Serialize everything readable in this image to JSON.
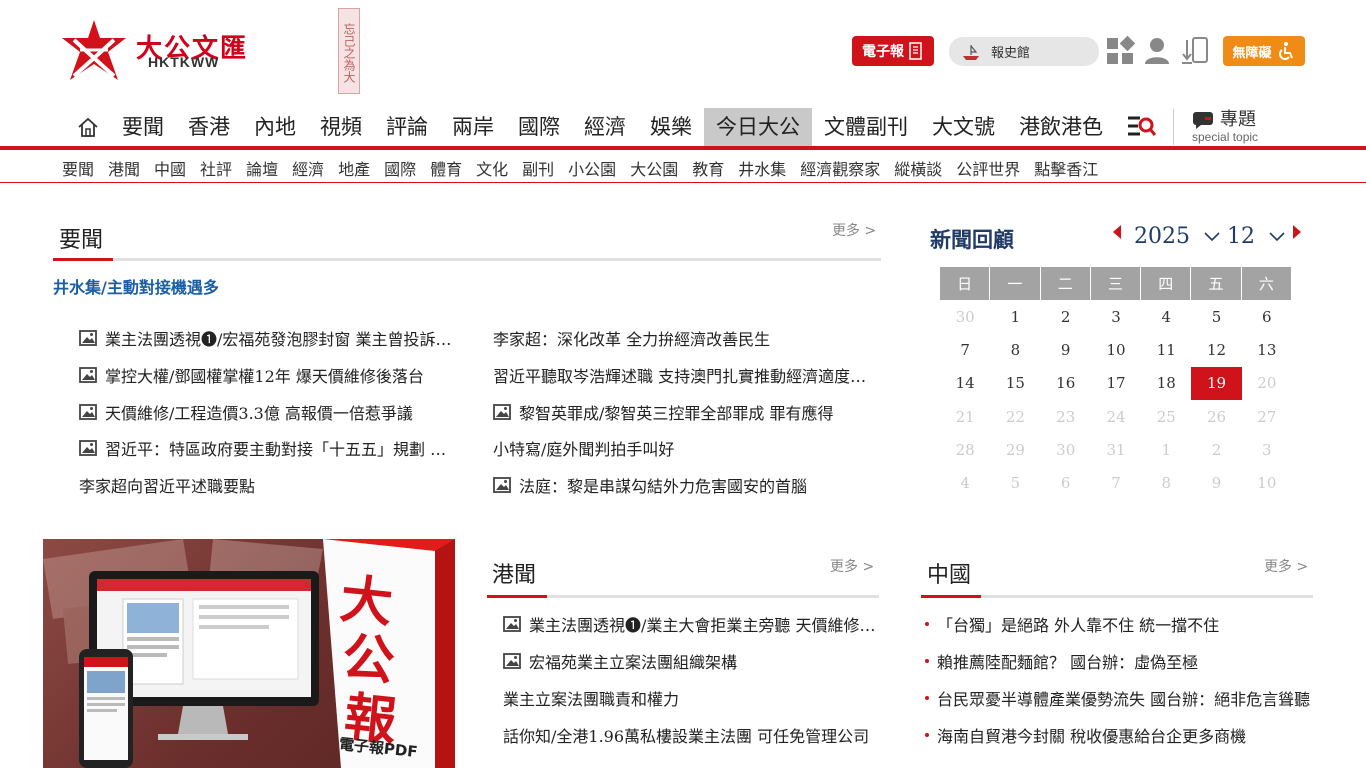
{
  "header": {
    "logo_text": "大公文匯",
    "logo_sub": "HKTKWW",
    "seal_text": "忘己之為大",
    "epaper_label": "電子報",
    "history_label": "報史館",
    "access_label": "無障礙"
  },
  "main_nav": {
    "items": [
      "要聞",
      "香港",
      "內地",
      "視頻",
      "評論",
      "兩岸",
      "國際",
      "經濟",
      "娛樂",
      "今日大公",
      "文體副刊",
      "大文號",
      "港飲港色"
    ],
    "active_index": 9,
    "special_label": "專題",
    "special_sub": "special topic"
  },
  "sub_nav": {
    "items": [
      "要聞",
      "港聞",
      "中國",
      "社評",
      "論壇",
      "經濟",
      "地產",
      "國際",
      "體育",
      "文化",
      "副刊",
      "小公園",
      "大公園",
      "教育",
      "井水集",
      "經濟觀察家",
      "縱橫談",
      "公評世界",
      "點擊香江"
    ]
  },
  "headlines": {
    "title": "要聞",
    "more": "更多 >",
    "featured": "井水集/主動對接機遇多",
    "left": [
      {
        "text": "業主法團透視❶/宏福苑發泡膠封窗 業主曾投訴…",
        "img": true
      },
      {
        "text": "掌控大權/鄧國權掌權12年 爆天價維修後落台",
        "img": true
      },
      {
        "text": "天價維修/工程造價3.3億 高報價一倍惹爭議",
        "img": true
      },
      {
        "text": "習近平：特區政府要主動對接「十五五」規劃 …",
        "img": true
      },
      {
        "text": "李家超向習近平述職要點",
        "img": false
      }
    ],
    "right": [
      {
        "text": "李家超：深化改革 全力拚經濟改善民生",
        "img": false
      },
      {
        "text": "習近平聽取岑浩輝述職 支持澳門扎實推動經濟適度…",
        "img": false
      },
      {
        "text": "黎智英罪成/黎智英三控罪全部罪成 罪有應得",
        "img": true
      },
      {
        "text": "小特寫/庭外聞判拍手叫好",
        "img": false
      },
      {
        "text": "法庭：黎是串謀勾結外力危害國安的首腦",
        "img": true
      }
    ]
  },
  "calendar": {
    "title": "新聞回顧",
    "year": "2025",
    "month": "12",
    "weekdays": [
      "日",
      "一",
      "二",
      "三",
      "四",
      "五",
      "六"
    ],
    "weeks": [
      [
        "30",
        "1",
        "2",
        "3",
        "4",
        "5",
        "6"
      ],
      [
        "7",
        "8",
        "9",
        "10",
        "11",
        "12",
        "13"
      ],
      [
        "14",
        "15",
        "16",
        "17",
        "18",
        "19",
        "20"
      ],
      [
        "21",
        "22",
        "23",
        "24",
        "25",
        "26",
        "27"
      ],
      [
        "28",
        "29",
        "30",
        "31",
        "1",
        "2",
        "3"
      ],
      [
        "4",
        "5",
        "6",
        "7",
        "8",
        "9",
        "10"
      ]
    ],
    "today": "19"
  },
  "promo": {
    "big1": "大",
    "big2": "公",
    "big3": "報",
    "sub": "電子報PDF"
  },
  "hk_news": {
    "title": "港聞",
    "more": "更多 >",
    "items": [
      {
        "text": "業主法團透視❶/業主大會拒業主旁聽 天價維修…",
        "img": true
      },
      {
        "text": "宏福苑業主立案法團組織架構",
        "img": true
      },
      {
        "text": "業主立案法團職責和權力",
        "img": false
      },
      {
        "text": "話你知/全港1.96萬私樓設業主法團 可任免管理公司",
        "img": false
      }
    ]
  },
  "china_news": {
    "title": "中國",
    "more": "更多 >",
    "items": [
      "「台獨」是絕路 外人靠不住 統一擋不住",
      "賴推薦陸配麵館？ 國台辦：虛偽至極",
      "台民眾憂半導體產業優勢流失 國台辦：絕非危言聳聽",
      "海南自貿港今封關 稅收優惠給台企更多商機"
    ]
  }
}
